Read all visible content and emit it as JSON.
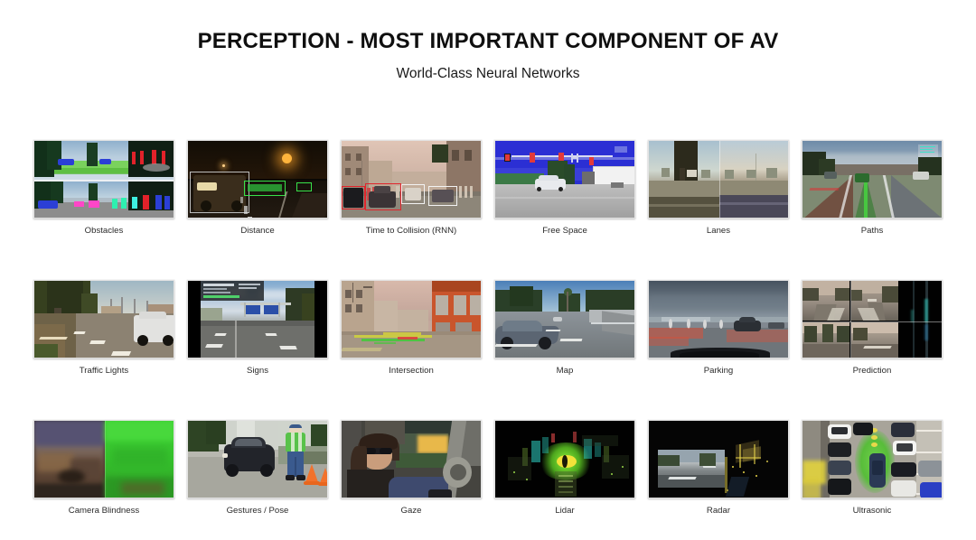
{
  "header": {
    "title": "PERCEPTION - MOST IMPORTANT COMPONENT OF AV",
    "subtitle": "World-Class Neural Networks"
  },
  "theme": {
    "background": "#ffffff",
    "title_color": "#0f0f0f",
    "caption_color": "#2b2b2b",
    "card_border": "#e3e3e3"
  },
  "grid": {
    "columns": 6,
    "rows": 3,
    "cells": [
      {
        "label": "Obstacles",
        "scene": "obstacles",
        "row": 1,
        "col": 1
      },
      {
        "label": "Distance",
        "scene": "distance",
        "row": 1,
        "col": 2
      },
      {
        "label": "Time to Collision (RNN)",
        "scene": "ttc",
        "row": 1,
        "col": 3
      },
      {
        "label": "Free Space",
        "scene": "freespace",
        "row": 1,
        "col": 4
      },
      {
        "label": "Lanes",
        "scene": "lanes",
        "row": 1,
        "col": 5
      },
      {
        "label": "Paths",
        "scene": "paths",
        "row": 1,
        "col": 6
      },
      {
        "label": "Traffic Lights",
        "scene": "trafficlights",
        "row": 2,
        "col": 1
      },
      {
        "label": "Signs",
        "scene": "signs",
        "row": 2,
        "col": 2
      },
      {
        "label": "Intersection",
        "scene": "intersection",
        "row": 2,
        "col": 3
      },
      {
        "label": "Map",
        "scene": "map",
        "row": 2,
        "col": 4
      },
      {
        "label": "Parking",
        "scene": "parking",
        "row": 2,
        "col": 5
      },
      {
        "label": "Prediction",
        "scene": "prediction",
        "row": 2,
        "col": 6
      },
      {
        "label": "Camera Blindness",
        "scene": "blindness",
        "row": 3,
        "col": 1
      },
      {
        "label": "Gestures / Pose",
        "scene": "gestures",
        "row": 3,
        "col": 2
      },
      {
        "label": "Gaze",
        "scene": "gaze",
        "row": 3,
        "col": 3
      },
      {
        "label": "Lidar",
        "scene": "lidar",
        "row": 3,
        "col": 4
      },
      {
        "label": "Radar",
        "scene": "radar",
        "row": 3,
        "col": 5
      },
      {
        "label": "Ultrasonic",
        "scene": "ultrasonic",
        "row": 3,
        "col": 6
      }
    ]
  }
}
